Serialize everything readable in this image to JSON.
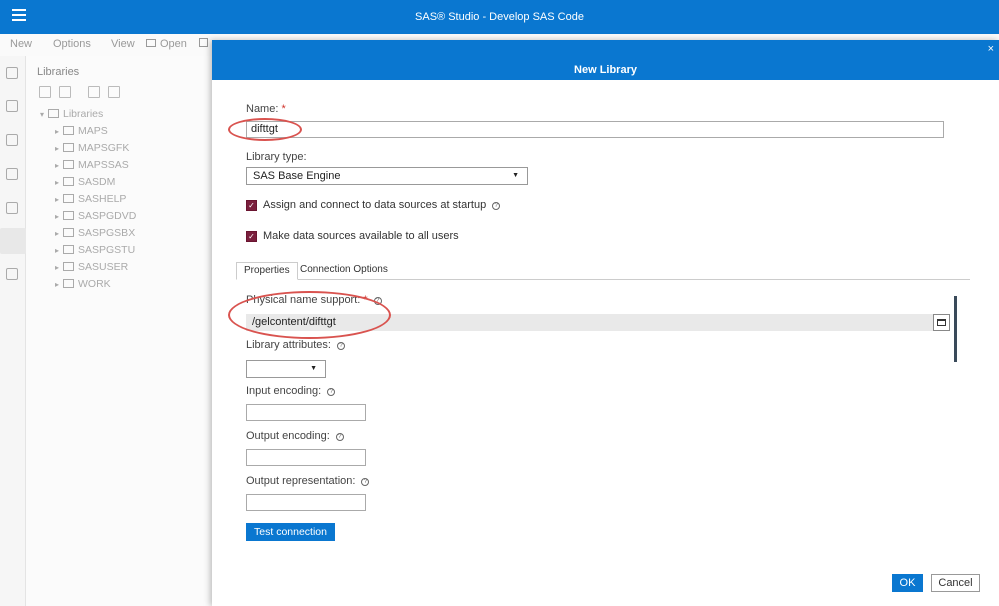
{
  "app": {
    "title": "SAS® Studio - Develop SAS Code"
  },
  "menu": {
    "new": "New",
    "options": "Options",
    "view": "View",
    "open": "Open"
  },
  "libraries": {
    "panel_title": "Libraries",
    "root": "Libraries",
    "items": [
      "MAPS",
      "MAPSGFK",
      "MAPSSAS",
      "SASDM",
      "SASHELP",
      "SASPGDVD",
      "SASPGSBX",
      "SASPGSTU",
      "SASUSER",
      "WORK"
    ]
  },
  "dialog": {
    "title": "New Library",
    "close": "×",
    "name_label": "Name:",
    "required_mark": "*",
    "name_value": "difttgt",
    "library_type_label": "Library type:",
    "library_type_value": "SAS Base Engine",
    "assign_label": "Assign and connect to data sources at startup",
    "assign_checked": true,
    "available_label": "Make data sources available to all users",
    "available_checked": true,
    "tabs": [
      "Properties",
      "Connection Options"
    ],
    "active_tab": "Properties",
    "physical_label": "Physical name support:",
    "physical_value": "/gelcontent/difttgt",
    "library_attributes_label": "Library attributes:",
    "library_attributes_value": "",
    "input_encoding_label": "Input encoding:",
    "input_encoding_value": "",
    "output_encoding_label": "Output encoding:",
    "output_encoding_value": "",
    "output_representation_label": "Output representation:",
    "output_representation_value": "",
    "test_connection": "Test connection",
    "ok": "OK",
    "cancel": "Cancel"
  },
  "colors": {
    "brand_blue": "#0a77d0",
    "checkbox": "#7a1f3d",
    "highlight": "#d9534f"
  }
}
